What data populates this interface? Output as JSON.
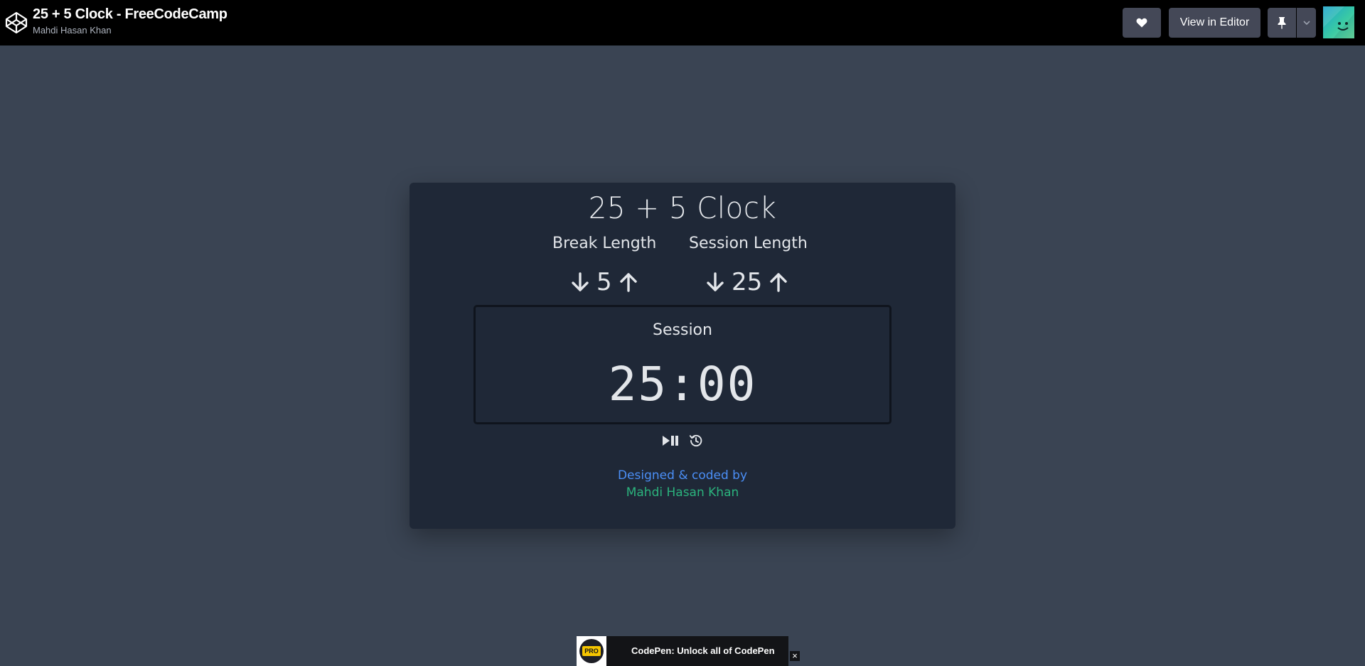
{
  "topbar": {
    "pen_title": "25 + 5 Clock - FreeCodeCamp",
    "author": "Mahdi Hasan Khan",
    "view_in_editor_label": "View in Editor",
    "icons": [
      "codepen-logo-icon",
      "heart-icon",
      "pin-icon",
      "chevron-down-icon",
      "avatar"
    ]
  },
  "clock": {
    "title": "25 + 5 Clock",
    "break_label": "Break Length",
    "break_length": "5",
    "session_label": "Session Length",
    "session_length": "25",
    "timer_label": "Session",
    "time_left": "25:00",
    "icons": [
      "arrow-down-icon",
      "arrow-up-icon",
      "play-pause-icon",
      "reset-icon"
    ]
  },
  "credits": {
    "line1": "Designed & coded by",
    "line2": "Mahdi Hasan Khan"
  },
  "promo": {
    "badge": "PRO",
    "text": "CodePen: Unlock all of CodePen",
    "close": "×"
  },
  "colors": {
    "page_bg": "#3a4453",
    "topbar_bg": "#000000",
    "card_bg": "#1f2837",
    "button_bg": "#444857",
    "credit_blue": "#4b8ff7",
    "credit_green": "#2bb37d",
    "pro_yellow": "#f6c500"
  }
}
